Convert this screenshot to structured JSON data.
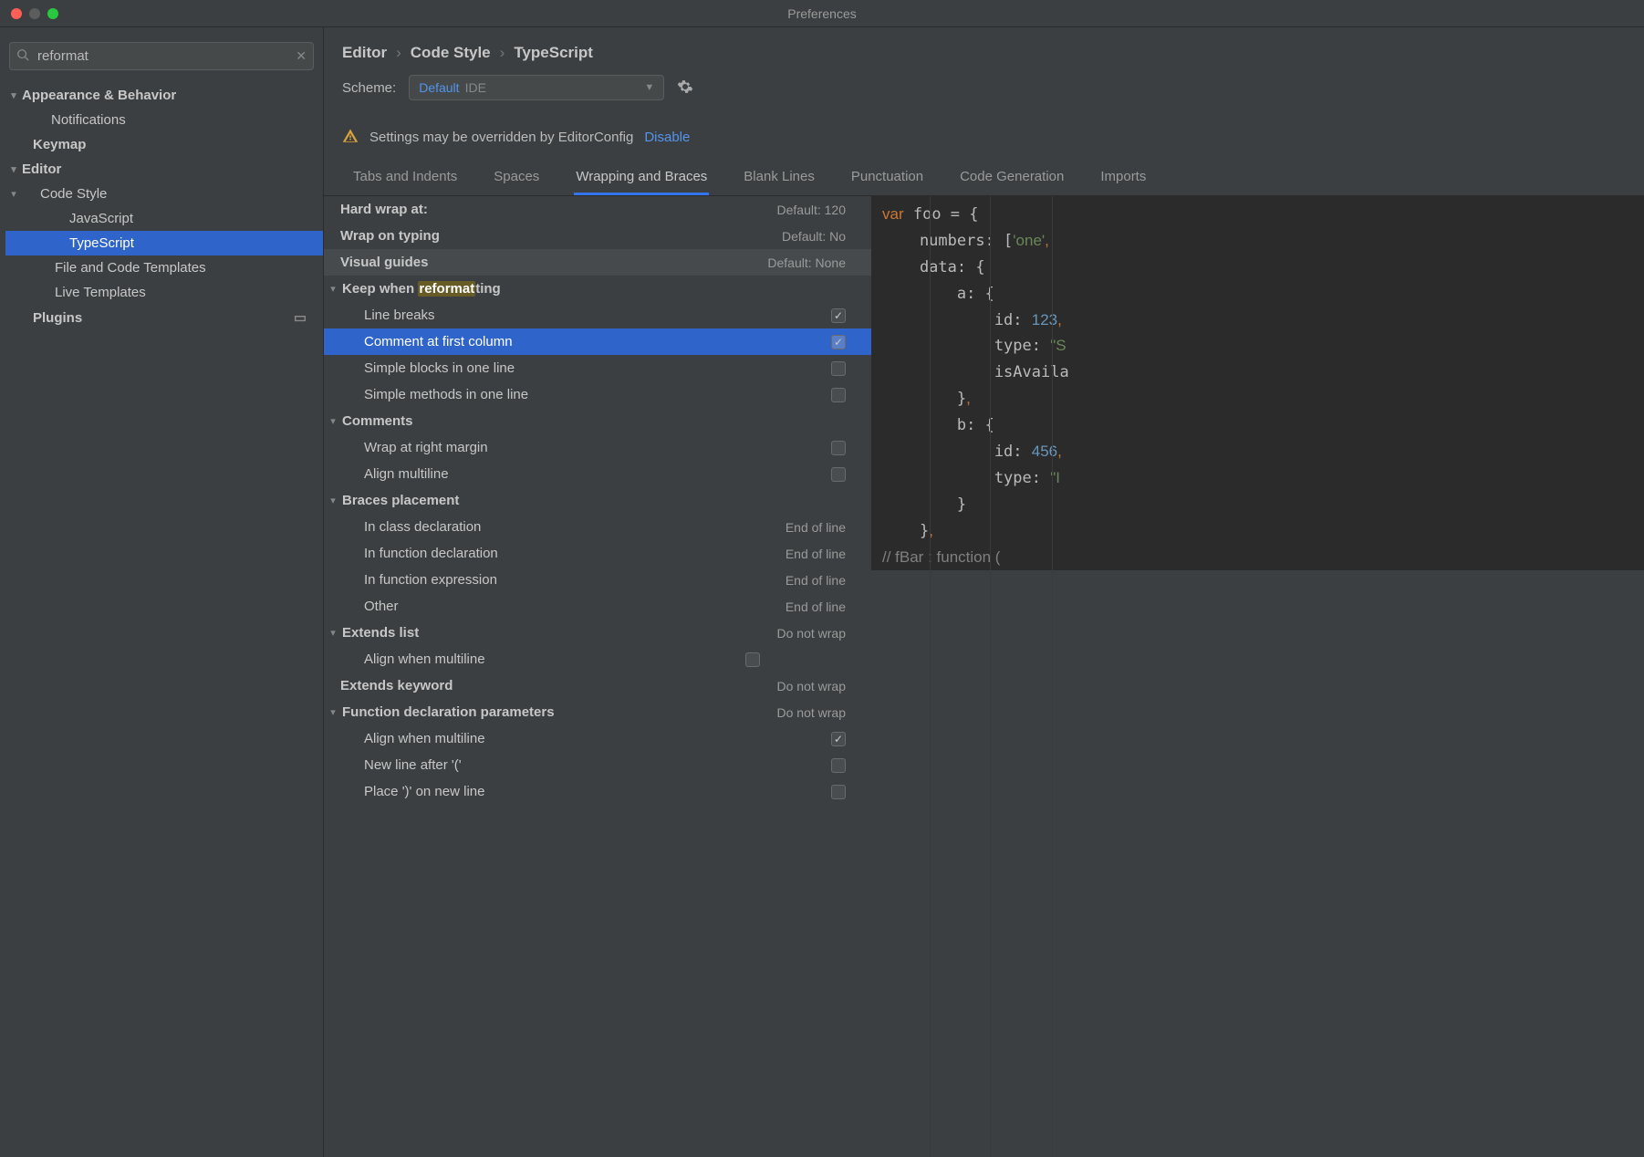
{
  "window_title": "Preferences",
  "search_value": "reformat",
  "sidebar": [
    {
      "label": "Appearance & Behavior",
      "bold": true,
      "chev": "down",
      "indent": 0
    },
    {
      "label": "Notifications",
      "bold": false,
      "chev": "",
      "indent": 32
    },
    {
      "label": "Keymap",
      "bold": true,
      "chev": "",
      "indent": 12
    },
    {
      "label": "Editor",
      "bold": true,
      "chev": "down",
      "indent": 0
    },
    {
      "label": "Code Style",
      "bold": false,
      "chev": "down",
      "indent": 20
    },
    {
      "label": "JavaScript",
      "bold": false,
      "chev": "",
      "indent": 52
    },
    {
      "label": "TypeScript",
      "bold": false,
      "chev": "",
      "indent": 52,
      "selected": true
    },
    {
      "label": "File and Code Templates",
      "bold": false,
      "chev": "",
      "indent": 36
    },
    {
      "label": "Live Templates",
      "bold": false,
      "chev": "",
      "indent": 36
    },
    {
      "label": "Plugins",
      "bold": true,
      "chev": "",
      "indent": 12,
      "pin": true
    }
  ],
  "breadcrumbs": [
    "Editor",
    "Code Style",
    "TypeScript"
  ],
  "scheme_label": "Scheme:",
  "scheme_value": "Default",
  "scheme_suffix": "IDE",
  "warning_text": "Settings may be overridden by EditorConfig",
  "warning_link": "Disable",
  "tabs": [
    "Tabs and Indents",
    "Spaces",
    "Wrapping and Braces",
    "Blank Lines",
    "Punctuation",
    "Code Generation",
    "Imports"
  ],
  "active_tab": 2,
  "settings": [
    {
      "type": "val",
      "label": "Hard wrap at:",
      "bold": true,
      "indent": 18,
      "value": "Default: 120"
    },
    {
      "type": "val",
      "label": "Wrap on typing",
      "bold": true,
      "indent": 18,
      "value": "Default: No"
    },
    {
      "type": "val",
      "label": "Visual guides",
      "bold": true,
      "indent": 18,
      "value": "Default: None",
      "hover": true
    },
    {
      "type": "hdr",
      "label_pre": "Keep when ",
      "label_hl": "reformat",
      "label_post": "ting",
      "bold": true,
      "indent": 0,
      "chev": "down"
    },
    {
      "type": "cb",
      "label": "Line breaks",
      "indent": 44,
      "checked": true
    },
    {
      "type": "cb",
      "label": "Comment at first column",
      "indent": 44,
      "checked": true,
      "selected": true
    },
    {
      "type": "cb",
      "label": "Simple blocks in one line",
      "indent": 44,
      "checked": false
    },
    {
      "type": "cb",
      "label": "Simple methods in one line",
      "indent": 44,
      "checked": false
    },
    {
      "type": "hdr",
      "label": "Comments",
      "bold": true,
      "indent": 0,
      "chev": "down"
    },
    {
      "type": "cb",
      "label": "Wrap at right margin",
      "indent": 44,
      "checked": false
    },
    {
      "type": "cb",
      "label": "Align multiline",
      "indent": 44,
      "checked": false
    },
    {
      "type": "hdr",
      "label": "Braces placement",
      "bold": true,
      "indent": 0,
      "chev": "down"
    },
    {
      "type": "val",
      "label": "In class declaration",
      "indent": 44,
      "value": "End of line"
    },
    {
      "type": "val",
      "label": "In function declaration",
      "indent": 44,
      "value": "End of line"
    },
    {
      "type": "val",
      "label": "In function expression",
      "indent": 44,
      "value": "End of line"
    },
    {
      "type": "val",
      "label": "Other",
      "indent": 44,
      "value": "End of line"
    },
    {
      "type": "hdrval",
      "label": "Extends list",
      "bold": true,
      "indent": 0,
      "chev": "down",
      "value": "Do not wrap"
    },
    {
      "type": "cb",
      "label": "Align when multiline",
      "indent": 44,
      "checked": false,
      "big": true
    },
    {
      "type": "val",
      "label": "Extends keyword",
      "bold": true,
      "indent": 18,
      "value": "Do not wrap"
    },
    {
      "type": "hdrval",
      "label": "Function declaration parameters",
      "bold": true,
      "indent": 0,
      "chev": "down",
      "value": "Do not wrap"
    },
    {
      "type": "cb",
      "label": "Align when multiline",
      "indent": 44,
      "checked": true
    },
    {
      "type": "cb",
      "label": "New line after '('",
      "indent": 44,
      "checked": false
    },
    {
      "type": "cb",
      "label": "Place ')' on new line",
      "indent": 44,
      "checked": false
    }
  ],
  "code": {
    "l1a": "var",
    "l1b": " foo = {",
    "l2": "    numbers: [",
    "l2s": "'one'",
    "l2e": ",",
    "l3": "    data: {",
    "l4": "        a: {",
    "l5a": "            id: ",
    "l5n": "123",
    "l5e": ",",
    "l6a": "            type: ",
    "l6s": "\"S",
    "l7": "            isAvaila",
    "l8": "        }",
    "l8e": ",",
    "l9": "        b: {",
    "l10a": "            id: ",
    "l10n": "456",
    "l10e": ",",
    "l11a": "            type: ",
    "l11s": "\"I",
    "l12": "        }",
    "l13": "    }",
    "l13e": ",",
    "l14": "// fBar : function ("
  }
}
